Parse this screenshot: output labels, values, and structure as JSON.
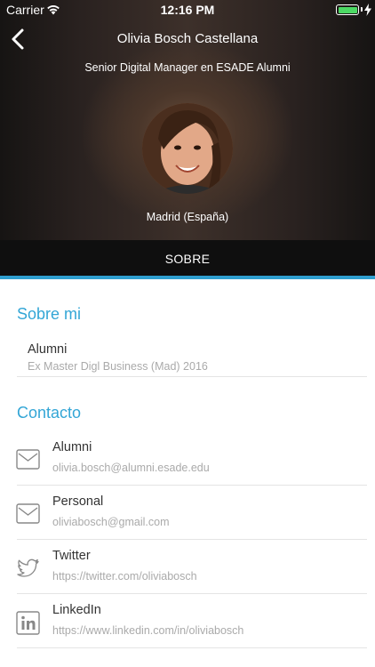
{
  "status_bar": {
    "carrier": "Carrier",
    "time": "12:16 PM",
    "battery_level": 1.0
  },
  "profile": {
    "name": "Olivia Bosch Castellana",
    "title": "Senior Digital Manager en ESADE Alumni",
    "location": "Madrid (España)"
  },
  "tabs": [
    {
      "label": "SOBRE",
      "active": true
    }
  ],
  "about": {
    "heading": "Sobre mi",
    "items": [
      {
        "title": "Alumni",
        "detail": "Ex Master Digl Business (Mad) 2016"
      }
    ]
  },
  "contact": {
    "heading": "Contacto",
    "items": [
      {
        "icon": "mail-icon",
        "title": "Alumni",
        "value": "olivia.bosch@alumni.esade.edu"
      },
      {
        "icon": "mail-icon",
        "title": "Personal",
        "value": "oliviabosch@gmail.com"
      },
      {
        "icon": "twitter-icon",
        "title": "Twitter",
        "value": "https://twitter.com/oliviabosch"
      },
      {
        "icon": "linkedin-icon",
        "title": "LinkedIn",
        "value": "https://www.linkedin.com/in/oliviabosch"
      }
    ]
  },
  "colors": {
    "accent": "#33a6d6",
    "tab_bar": "#0f0f0f",
    "battery": "#4cd964"
  }
}
